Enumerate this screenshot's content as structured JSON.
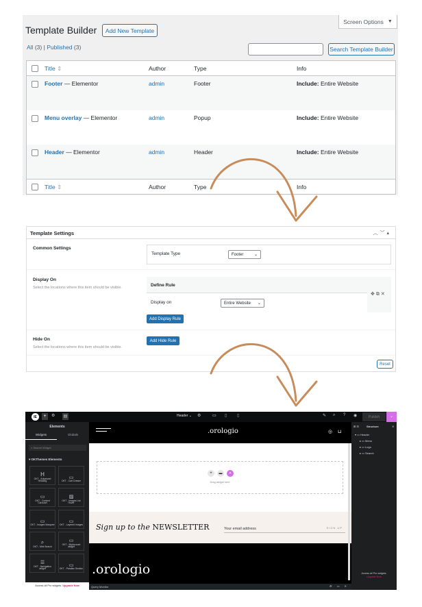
{
  "template_builder": {
    "screen_options": "Screen Options",
    "title": "Template Builder",
    "add_new": "Add New Template",
    "filter_all": "All",
    "filter_all_count": "(3)",
    "filter_sep": "|",
    "filter_published": "Published",
    "filter_published_count": "(3)",
    "search_button": "Search Template Builder",
    "columns": {
      "title": "Title",
      "author": "Author",
      "type": "Type",
      "info": "Info"
    },
    "rows": [
      {
        "name": "Footer",
        "suffix": " — Elementor",
        "author": "admin",
        "type": "Footer",
        "info_label": "Include:",
        "info_value": " Entire Website"
      },
      {
        "name": "Menu overlay",
        "suffix": " — Elementor",
        "author": "admin",
        "type": "Popup",
        "info_label": "Include:",
        "info_value": " Entire Website"
      },
      {
        "name": "Header",
        "suffix": " — Elementor",
        "author": "admin",
        "type": "Header",
        "info_label": "Include:",
        "info_value": " Entire Website"
      }
    ]
  },
  "template_settings": {
    "title": "Template Settings",
    "common_settings": "Common Settings",
    "template_type_label": "Template Type",
    "template_type_value": "Footer",
    "display_on": "Display On",
    "display_on_desc": "Select the locations where this item should be visible.",
    "define_rule": "Define Rule",
    "display_on_field": "Display on",
    "display_on_value": "Entire Website",
    "add_display_rule": "Add Display Rule",
    "hide_on": "Hide On",
    "hide_on_desc": "Select the locations where this item should be visible.",
    "add_hide_rule": "Add Hide Rule",
    "reset": "Reset"
  },
  "elementor": {
    "topbar_doc": "Header",
    "publish": "Publish",
    "panel_title": "Elements",
    "tab_widgets": "Widgets",
    "tab_globals": "Globals",
    "search_placeholder": "Search Widget",
    "category": "OKThemes Elements",
    "widgets": [
      "OKT - Advanced Heading",
      "OKT - Cart Drawer",
      "OKT - Content Carousel",
      "OKT - Images List Hover",
      "OKT - Images Marquee",
      "OKT - Layered Images",
      "OKT - Mini Search",
      "OKT - MyAccount widget",
      "OKT - Navigation widget",
      "OKT - Parallax Section"
    ],
    "pro_note": "Access all Pro widgets.",
    "upgrade": "Upgrade Now",
    "site_logo": ".orologio",
    "drag_hint": "Drag widget here",
    "newsletter_italic": "Sign up to the",
    "newsletter_caps": "NEWSLETTER",
    "email_placeholder": "Your email address",
    "signup": "SIGN UP",
    "footer_logo": ".orologio",
    "structure_title": "Structure",
    "structure_items": [
      "Header",
      "Menu",
      "Logo",
      "Search"
    ],
    "query_monitor": "Query Monitor",
    "right_pro_note": "Access all Pro widgets.",
    "right_upgrade": "Upgrade Now"
  },
  "colors": {
    "wp_blue": "#2271b1",
    "arrow": "#c88b5a",
    "elementor_pink": "#d66ee8",
    "upgrade_red": "#e2186f"
  }
}
